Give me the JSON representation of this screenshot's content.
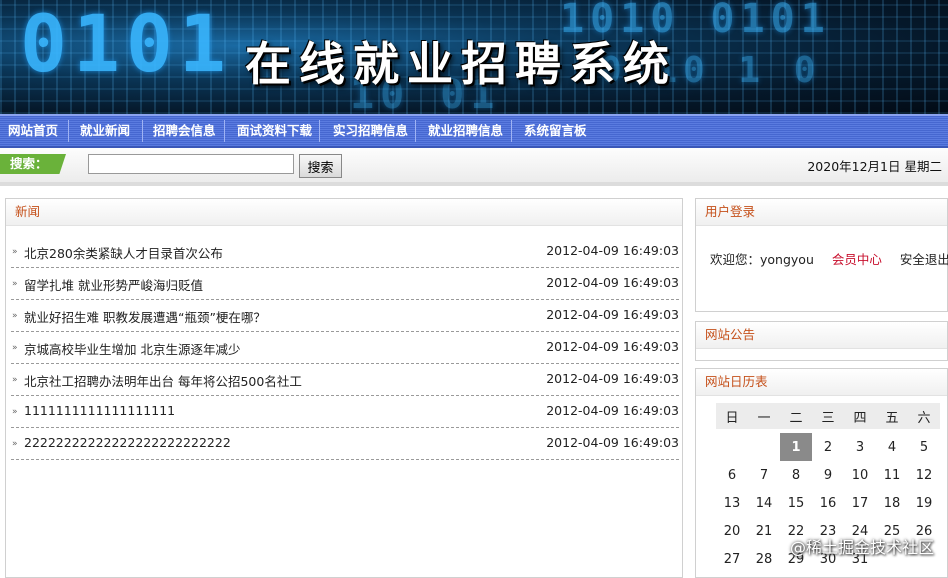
{
  "banner": {
    "title": "在线就业招聘系统",
    "digits_a": "0101",
    "digits_b": "1010 0101",
    "digits_c": "0110 1 0",
    "digits_d": "10 01"
  },
  "nav": [
    "网站首页",
    "就业新闻",
    "招聘会信息",
    "面试资料下载",
    "实习招聘信息",
    "就业招聘信息",
    "系统留言板"
  ],
  "search": {
    "label": "搜索：",
    "value": "",
    "button": "搜索",
    "date": "2020年12月1日 星期二"
  },
  "news": {
    "title": "新闻",
    "items": [
      {
        "title": "北京280余类紧缺人才目录首次公布",
        "date": "2012-04-09 16:49:03"
      },
      {
        "title": "留学扎堆 就业形势严峻海归贬值",
        "date": "2012-04-09 16:49:03"
      },
      {
        "title": "就业好招生难 职教发展遭遇“瓶颈”梗在哪？",
        "date": "2012-04-09 16:49:03"
      },
      {
        "title": "京城高校毕业生增加 北京生源逐年减少",
        "date": "2012-04-09 16:49:03"
      },
      {
        "title": "北京社工招聘办法明年出台 每年将公招500名社工",
        "date": "2012-04-09 16:49:03"
      },
      {
        "title": "1111111111111111111",
        "date": "2012-04-09 16:49:03"
      },
      {
        "title": "22222222222222222222222222",
        "date": "2012-04-09 16:49:03"
      }
    ]
  },
  "login": {
    "title": "用户登录",
    "welcome": "欢迎您：yongyou",
    "member": "会员中心",
    "logout": "安全退出"
  },
  "notice": {
    "title": "网站公告"
  },
  "calendar": {
    "title": "网站日历表",
    "weekdays": [
      "日",
      "一",
      "二",
      "三",
      "四",
      "五",
      "六"
    ],
    "weeks": [
      [
        "",
        "",
        "1",
        "2",
        "3",
        "4",
        "5"
      ],
      [
        "6",
        "7",
        "8",
        "9",
        "10",
        "11",
        "12"
      ],
      [
        "13",
        "14",
        "15",
        "16",
        "17",
        "18",
        "19"
      ],
      [
        "20",
        "21",
        "22",
        "23",
        "24",
        "25",
        "26"
      ],
      [
        "27",
        "28",
        "29",
        "30",
        "31",
        "",
        ""
      ]
    ],
    "today": "1"
  },
  "watermark": "@稀土掘金技术社区"
}
